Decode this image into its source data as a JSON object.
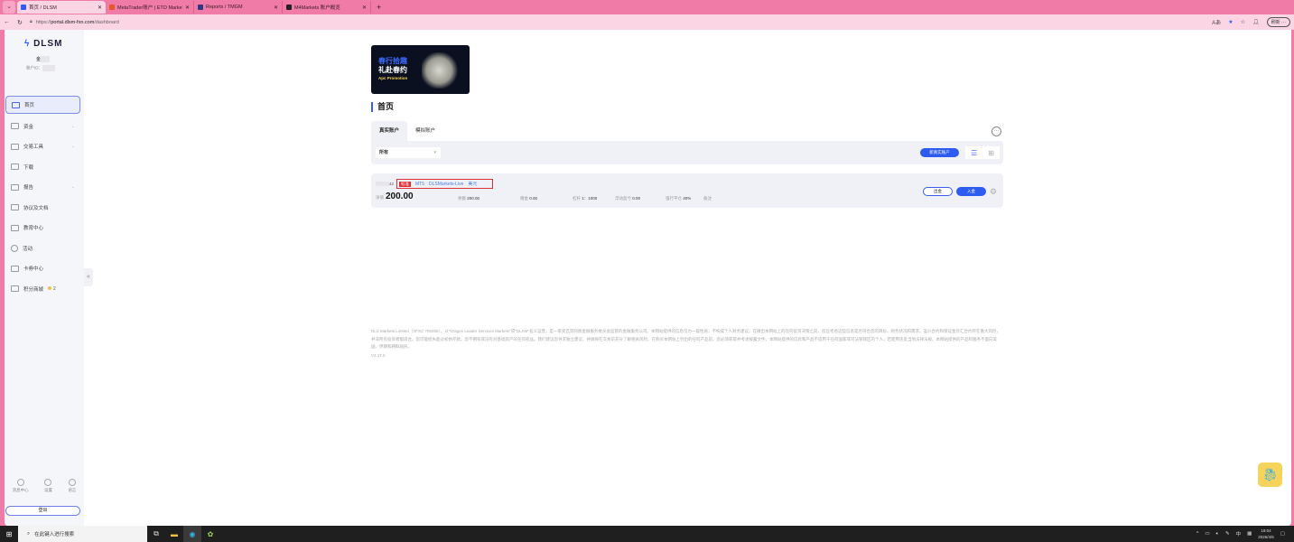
{
  "browser": {
    "tabs": [
      {
        "title": "首页 / DLSM",
        "color": "#2e5bff",
        "active": true
      },
      {
        "title": "MetaTrader账户 | ETO Markets Live",
        "color": "#e8562a"
      },
      {
        "title": "Reports / TMGM",
        "color": "#2a3a8a"
      },
      {
        "title": "M4Markets 账户概览",
        "color": "#222222"
      }
    ],
    "url_prefix": "https://",
    "url_host": "portal.dlsm-fxn.com",
    "url_path": "/dashboard",
    "refresh_label": "刷新"
  },
  "sidebar": {
    "logo": "DLSM",
    "user_name": "金",
    "account_id_label": "账户ID：",
    "items": [
      {
        "label": "首页",
        "active": true
      },
      {
        "label": "资金",
        "expandable": true
      },
      {
        "label": "交易工具",
        "expandable": true
      },
      {
        "label": "下载"
      },
      {
        "label": "报告",
        "expandable": true
      },
      {
        "label": "协议及文档"
      },
      {
        "label": "教育中心"
      },
      {
        "label": "活动"
      },
      {
        "label": "卡券中心"
      },
      {
        "label": "积分商城",
        "badge": "2"
      }
    ],
    "bottom": [
      {
        "label": "消息中心"
      },
      {
        "label": "设置"
      },
      {
        "label": "语言"
      }
    ],
    "logout": "登出"
  },
  "banner": {
    "line1": "春行拾趣",
    "line2": "礼赴春约",
    "line3": "Apc Promotion"
  },
  "page_title": "首页",
  "account_tabs": [
    "真实账户",
    "模拟账户"
  ],
  "filter": {
    "selected": "所有",
    "new_account": "新真实账户"
  },
  "account": {
    "id_suffix": "42",
    "tag": "标准",
    "platform": "MT5",
    "server": "DLSMarkets-Live",
    "currency": "美元",
    "equity_label": "净值",
    "equity": "200.00",
    "balance_label": "余额",
    "balance": "200.00",
    "bonus_label": "赠金",
    "bonus": "0.00",
    "leverage_label": "杠杆",
    "leverage": "1：1000",
    "floating_label": "浮动盈亏",
    "floating": "0.00",
    "stopout_label": "强行平仓",
    "stopout": "40%",
    "remark_label": "备注",
    "withdraw": "出金",
    "deposit": "入金"
  },
  "footer": {
    "text": "DLS Markets Limited（VFSC 700455），以\"Dragon Leader Services Markets\"或\"DLSM\"名义运营，是一家受瓦努阿图金融服务委员会监管的金融服务公司。本网站提供的信息仅为一般性质，不构成个人财务建议。在做出本网站上的任何投资决策之前，您应考虑这些信息是否符合您的目标、财务状况和需求。差价合约和保证金外汇合约存在重大风险，并非所有投资者都适合。您可能损失超过初始存款。您不拥有或没有对基础资产的任何权益。我们建议您寻求独立建议，并确保在交易前充分了解相关风险。在购买本网站上列出的任何产品前，您必须获取并考虑披露文件。本网站提供的信息和产品不适用于任何国家或司法管辖区的个人，若使用违反当地法律法规。本网站提供的产品和服务不面向美国、伊朗和朝鲜居民。",
    "version": "V3.17.0"
  },
  "taskbar": {
    "search_placeholder": "在此键入进行搜索",
    "time": "19:04",
    "date": "2026/4/6",
    "ime": "中"
  }
}
